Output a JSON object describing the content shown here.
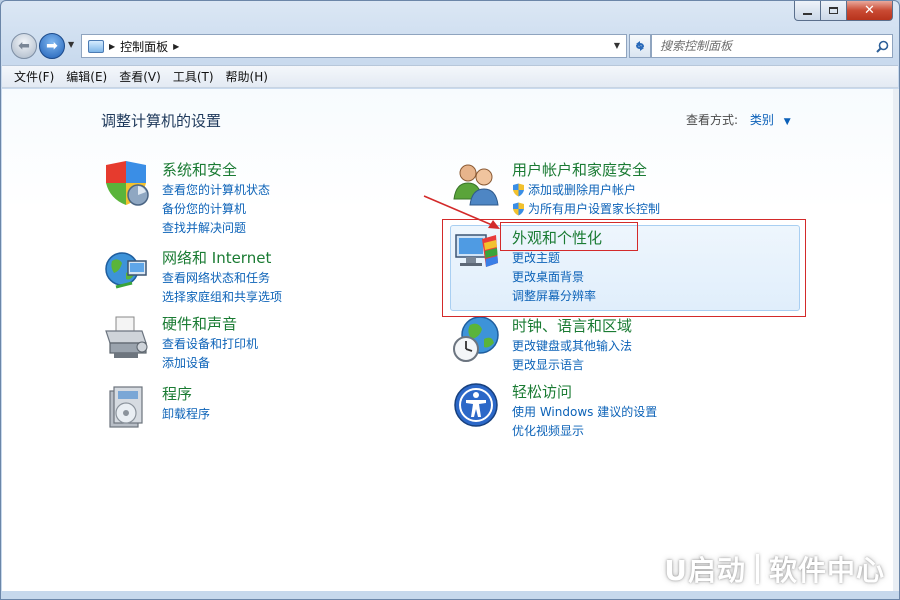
{
  "address": {
    "path": "控制面板"
  },
  "search": {
    "placeholder": "搜索控制面板"
  },
  "menu": {
    "items": [
      "文件(F)",
      "编辑(E)",
      "查看(V)",
      "工具(T)",
      "帮助(H)"
    ]
  },
  "page": {
    "title": "调整计算机的设置",
    "view_by_label": "查看方式:",
    "view_by_value": "类别"
  },
  "categories": {
    "system": {
      "title": "系统和安全",
      "links": [
        "查看您的计算机状态",
        "备份您的计算机",
        "查找并解决问题"
      ]
    },
    "network": {
      "title": "网络和 Internet",
      "links": [
        "查看网络状态和任务",
        "选择家庭组和共享选项"
      ]
    },
    "hardware": {
      "title": "硬件和声音",
      "links": [
        "查看设备和打印机",
        "添加设备"
      ]
    },
    "programs": {
      "title": "程序",
      "links": [
        "卸载程序"
      ]
    },
    "accounts": {
      "title": "用户帐户和家庭安全",
      "links": [
        "添加或删除用户帐户",
        "为所有用户设置家长控制"
      ]
    },
    "appearance": {
      "title": "外观和个性化",
      "links": [
        "更改主题",
        "更改桌面背景",
        "调整屏幕分辨率"
      ]
    },
    "clock": {
      "title": "时钟、语言和区域",
      "links": [
        "更改键盘或其他输入法",
        "更改显示语言"
      ]
    },
    "ease": {
      "title": "轻松访问",
      "links": [
        "使用 Windows 建议的设置",
        "优化视频显示"
      ]
    }
  },
  "watermark": {
    "brand": "U启动",
    "suffix": "软件中心"
  },
  "colors": {
    "category_title": "#1a7b33",
    "link": "#0d63b8",
    "annotation": "#d32a2a",
    "close_button": "#c94a33"
  }
}
